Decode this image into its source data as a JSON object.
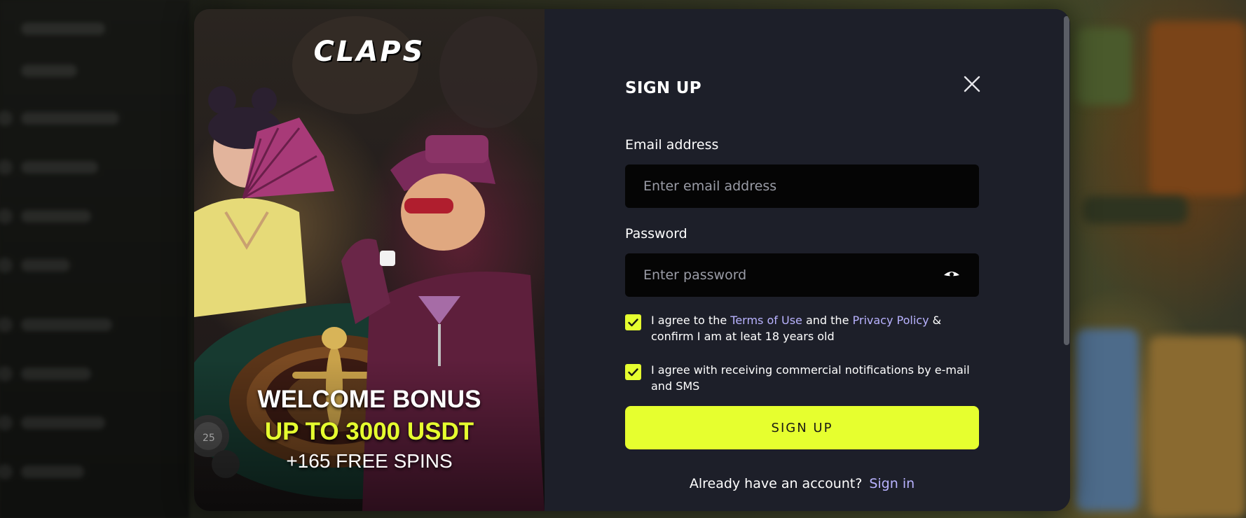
{
  "promo": {
    "logo": "CLAPS",
    "bonus_title": "WELCOME BONUS",
    "bonus_amount": "UP TO 3000 USDT",
    "bonus_spins": "+165 FREE SPINS",
    "chip_value": "25"
  },
  "form": {
    "title": "SIGN UP",
    "email": {
      "label": "Email address",
      "placeholder": "Enter email address",
      "value": ""
    },
    "password": {
      "label": "Password",
      "placeholder": "Enter password",
      "value": "",
      "toggle_icon": "eye-icon"
    },
    "terms": {
      "checked": true,
      "text_before": "I agree to the ",
      "terms_link": "Terms of Use",
      "text_middle": " and the ",
      "privacy_link": "Privacy Policy",
      "text_after": " & confirm I am at leat 18 years old"
    },
    "marketing": {
      "checked": true,
      "text": "I agree with receiving commercial notifications by e-mail and SMS"
    },
    "submit_label": "SIGN UP",
    "signin_prompt": "Already have an account?",
    "signin_link": "Sign in",
    "close_icon": "close-icon"
  },
  "colors": {
    "accent": "#e6ff2f",
    "link": "#b9b3ff",
    "panel": "#1d1f29",
    "input_bg": "#050505"
  }
}
